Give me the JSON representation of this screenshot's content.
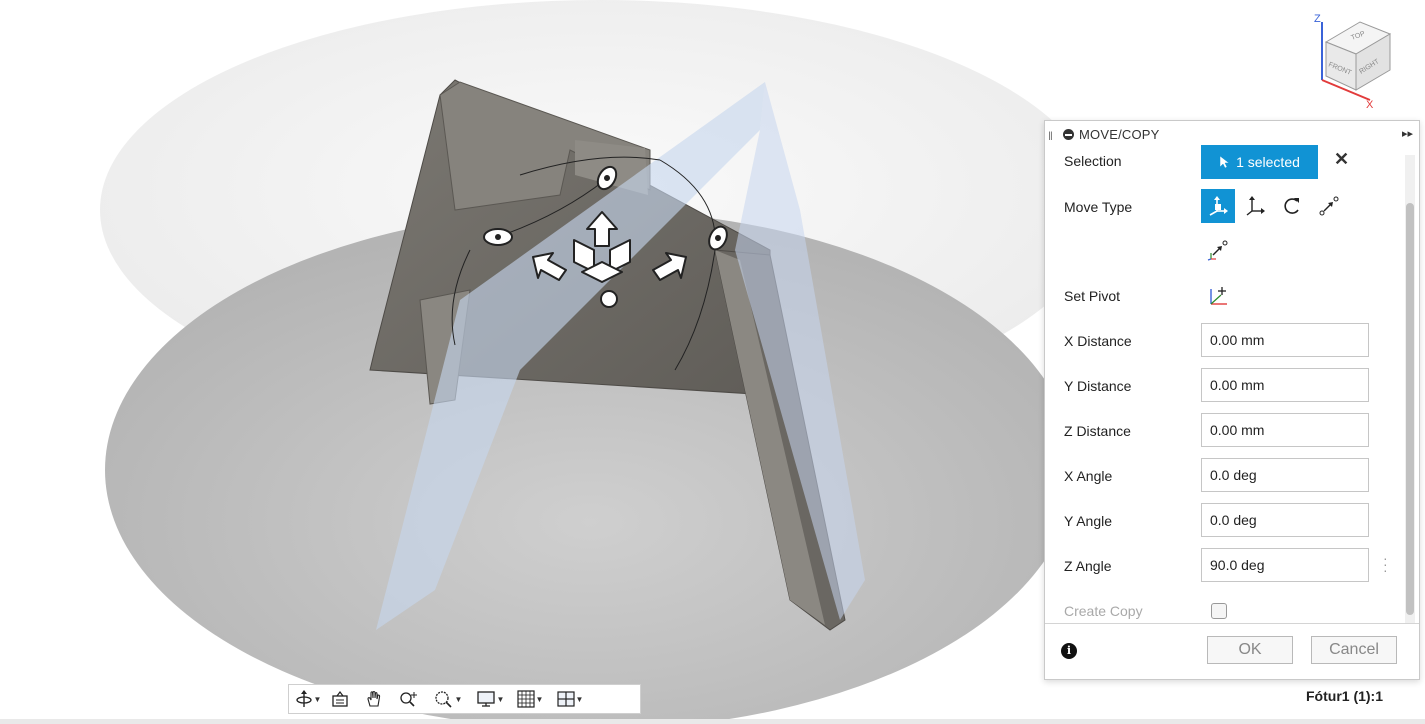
{
  "panel": {
    "title": "MOVE/COPY",
    "selection": {
      "label": "Selection",
      "value": "1 selected"
    },
    "move_type": {
      "label": "Move Type",
      "options": [
        "free-move-icon",
        "translate-icon",
        "rotate-icon",
        "point-to-point-icon",
        "point-to-position-icon"
      ],
      "selected": "free-move-icon"
    },
    "set_pivot": {
      "label": "Set Pivot"
    },
    "fields": [
      {
        "label": "X Distance",
        "value": "0.00 mm"
      },
      {
        "label": "Y Distance",
        "value": "0.00 mm"
      },
      {
        "label": "Z Distance",
        "value": "0.00 mm"
      },
      {
        "label": "X Angle",
        "value": "0.0 deg"
      },
      {
        "label": "Y Angle",
        "value": "0.0 deg"
      },
      {
        "label": "Z Angle",
        "value": "90.0 deg"
      }
    ],
    "create_copy": {
      "label": "Create Copy",
      "checked": false
    },
    "ok_label": "OK",
    "cancel_label": "Cancel"
  },
  "viewcube": {
    "axis_z": "Z",
    "axis_x": "X",
    "face_top": "TOP",
    "face_front": "FRONT",
    "face_right": "RIGHT"
  },
  "document_label": "Fótur1 (1):1",
  "colors": {
    "accent": "#1193d4",
    "model": "#6f6c66",
    "ground": "#bdbdbd",
    "plane": "#c9d8ec"
  }
}
